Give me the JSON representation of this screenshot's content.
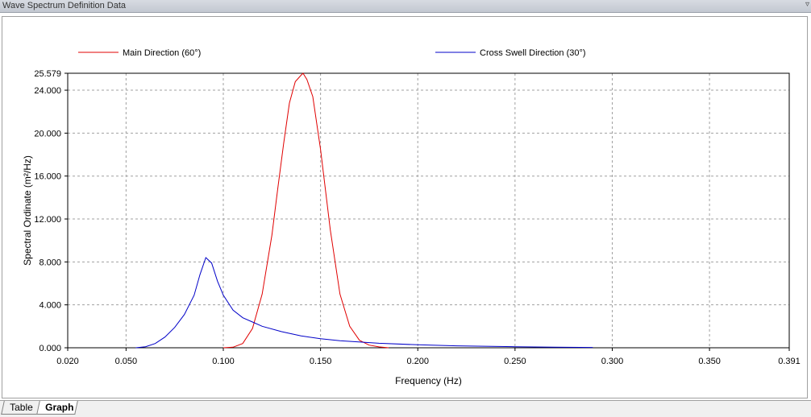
{
  "window": {
    "title": "Wave Spectrum Definition Data"
  },
  "tabs": [
    {
      "label": "Table",
      "active": false
    },
    {
      "label": "Graph",
      "active": true
    }
  ],
  "chart_data": {
    "type": "line",
    "title": "",
    "xlabel": "Frequency (Hz)",
    "ylabel": "Spectral Ordinate (m²/Hz)",
    "xlim": [
      0.02,
      0.391
    ],
    "ylim": [
      0,
      25.579
    ],
    "x_ticks": [
      "0.020",
      "0.050",
      "0.100",
      "0.150",
      "0.200",
      "0.250",
      "0.300",
      "0.350",
      "0.391"
    ],
    "x_tick_values": [
      0.02,
      0.05,
      0.1,
      0.15,
      0.2,
      0.25,
      0.3,
      0.35,
      0.391
    ],
    "y_ticks": [
      "0.000",
      "4.000",
      "8.000",
      "12.000",
      "16.000",
      "20.000",
      "24.000",
      "25.579"
    ],
    "y_tick_values": [
      0,
      4,
      8,
      12,
      16,
      20,
      24,
      25.579
    ],
    "grid": true,
    "legend_position": "top",
    "series": [
      {
        "name": "Main Direction (60°)",
        "color": "#e00000",
        "x": [
          0.1,
          0.105,
          0.11,
          0.115,
          0.12,
          0.125,
          0.128,
          0.131,
          0.134,
          0.137,
          0.14,
          0.141,
          0.143,
          0.146,
          0.15,
          0.155,
          0.16,
          0.165,
          0.17,
          0.175,
          0.18,
          0.185
        ],
        "y": [
          0.0,
          0.05,
          0.4,
          1.8,
          5.0,
          10.5,
          14.8,
          19.0,
          22.8,
          24.8,
          25.4,
          25.579,
          25.0,
          23.4,
          18.5,
          11.0,
          5.0,
          2.0,
          0.7,
          0.25,
          0.08,
          0.0
        ]
      },
      {
        "name": "Cross Swell Direction (30°)",
        "color": "#0000c8",
        "x": [
          0.055,
          0.06,
          0.065,
          0.07,
          0.075,
          0.08,
          0.085,
          0.088,
          0.091,
          0.094,
          0.097,
          0.1,
          0.105,
          0.11,
          0.115,
          0.12,
          0.13,
          0.14,
          0.15,
          0.16,
          0.18,
          0.2,
          0.22,
          0.25,
          0.27,
          0.29
        ],
        "y": [
          0.0,
          0.1,
          0.4,
          1.0,
          1.9,
          3.1,
          4.9,
          6.8,
          8.4,
          7.9,
          6.2,
          4.9,
          3.5,
          2.8,
          2.4,
          2.0,
          1.5,
          1.1,
          0.85,
          0.65,
          0.42,
          0.28,
          0.18,
          0.1,
          0.06,
          0.03
        ]
      }
    ]
  }
}
